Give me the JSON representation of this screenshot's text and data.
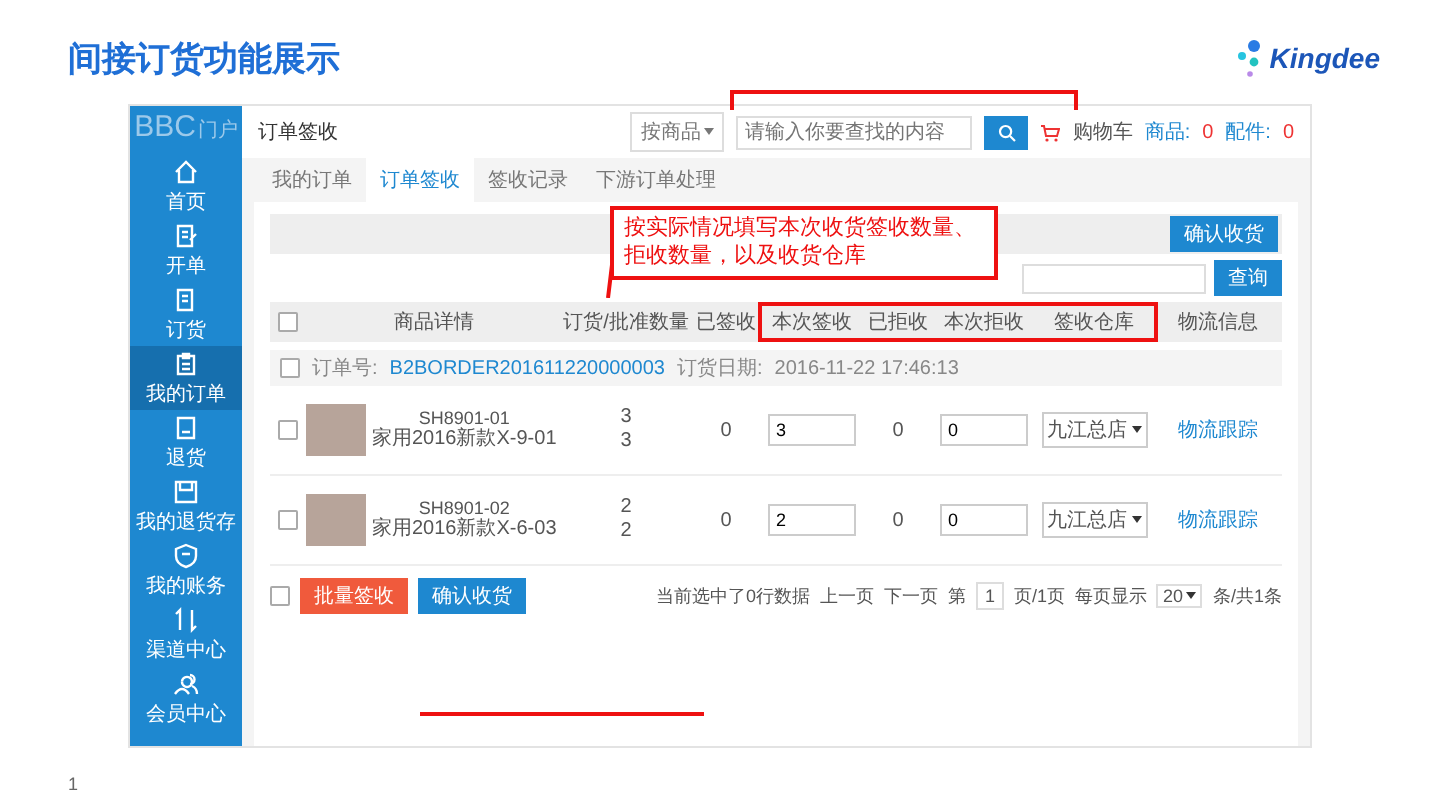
{
  "slide_title": "间接订货功能展示",
  "logo": {
    "text": "Kingdee"
  },
  "app": {
    "brand": {
      "text": "BBC",
      "suffix": "门户"
    },
    "sidebar": [
      {
        "label": "首页",
        "selected": false
      },
      {
        "label": "开单",
        "selected": false
      },
      {
        "label": "订货",
        "selected": false
      },
      {
        "label": "我的订单",
        "selected": true
      },
      {
        "label": "退货",
        "selected": false
      },
      {
        "label": "我的退货存",
        "selected": false
      },
      {
        "label": "我的账务",
        "selected": false
      },
      {
        "label": "渠道中心",
        "selected": false
      },
      {
        "label": "会员中心",
        "selected": false
      }
    ],
    "header": {
      "title": "订单签收",
      "search_scope": "按商品",
      "search_placeholder": "请输入你要查找的内容",
      "cart_label": "购物车",
      "goods_label": "商品:",
      "goods_count": "0",
      "parts_label": "配件:",
      "parts_count": "0"
    },
    "tabs": [
      {
        "label": "我的订单",
        "selected": false
      },
      {
        "label": "订单签收",
        "selected": true
      },
      {
        "label": "签收记录",
        "selected": false
      },
      {
        "label": "下游订单处理",
        "selected": false
      }
    ],
    "toolbar": {
      "confirm_button": "确认收货",
      "query_button": "查询"
    },
    "table": {
      "select_all": {
        "checked": false
      },
      "columns": [
        "商品详情",
        "订货/批准数量",
        "已签收",
        "本次签收",
        "已拒收",
        "本次拒收",
        "签收仓库",
        "物流信息"
      ],
      "order": {
        "checked": false,
        "number_label": "订单号:",
        "number": "B2BORDER201611220000003",
        "date_label": "订货日期:",
        "date": "2016-11-22 17:46:13"
      },
      "rows": [
        {
          "checked": false,
          "code": "SH8901-01",
          "name": "家用2016新款X-9-01",
          "ordered": "3",
          "approved": "3",
          "signed": "0",
          "sign_now": "3",
          "rejected": "0",
          "reject_now": "0",
          "warehouse": "九江总店",
          "logistics": "物流跟踪"
        },
        {
          "checked": false,
          "code": "SH8901-02",
          "name": "家用2016新款X-6-03",
          "ordered": "2",
          "approved": "2",
          "signed": "0",
          "sign_now": "2",
          "rejected": "0",
          "reject_now": "0",
          "warehouse": "九江总店",
          "logistics": "物流跟踪"
        }
      ]
    },
    "footer": {
      "checked": false,
      "batch_button": "批量签收",
      "confirm_button": "确认收货",
      "status": "当前选中了0行数据",
      "prev": "上一页",
      "next": "下一页",
      "page_prefix": "第",
      "page": "1",
      "page_suffix": "页/1页",
      "per_page_label": "每页显示",
      "per_page": "20",
      "total": "条/共1条"
    }
  },
  "callout": {
    "text": "按实际情况填写本次收货签收数量、拒收数量，以及收货仓库"
  },
  "page_number": "1"
}
